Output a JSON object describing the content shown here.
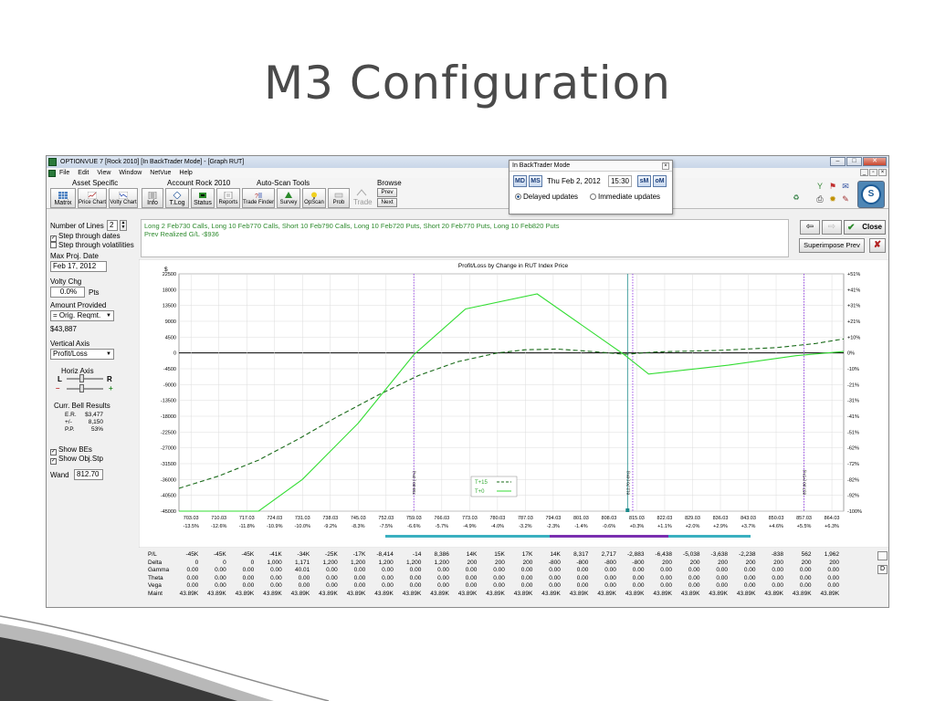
{
  "slide": {
    "title": "M3 Configuration"
  },
  "window": {
    "title": "OPTIONVUE 7  [Rock 2010]  [In BackTrader Mode] - [Graph RUT]",
    "controls": [
      "–",
      "□",
      "✕"
    ]
  },
  "menu": [
    "File",
    "Edit",
    "View",
    "Window",
    "NetVue",
    "Help"
  ],
  "toolbar": {
    "groups": {
      "asset_specific": "Asset Specific",
      "account": "Account Rock 2010",
      "autoscan": "Auto-Scan Tools",
      "browse": "Browse"
    },
    "buttons": [
      {
        "label": "Matrix"
      },
      {
        "label": "Price Chart"
      },
      {
        "label": "Volty Chart"
      },
      {
        "label": "Info"
      },
      {
        "label": "T.Log"
      },
      {
        "label": "Status"
      },
      {
        "label": "Reports"
      },
      {
        "label": "Trade Finder"
      },
      {
        "label": "Survey"
      },
      {
        "label": "OpScan"
      },
      {
        "label": "Prob"
      }
    ],
    "trade_label": "Trade",
    "prev": "Prev",
    "next": "Next"
  },
  "backtrader": {
    "title": "In BackTrader Mode",
    "btn_md": "MD",
    "btn_ms": "MS",
    "date": "Thu Feb 2, 2012",
    "time": "15:30",
    "btn_sm": "sM",
    "btn_om": "oM",
    "delayed": "Delayed updates",
    "immediate": "Immediate updates"
  },
  "left_panel": {
    "number_of_lines_label": "Number of Lines",
    "number_of_lines_value": "2",
    "step_dates": "Step through dates",
    "step_volatilities": "Step through volatilities",
    "max_proj_date_label": "Max Proj. Date",
    "max_proj_date_value": "Feb 17, 2012",
    "volty_chg_label": "Volty Chg",
    "volty_chg_value": "0.0%",
    "volty_chg_unit": "Pts",
    "amount_provided_label": "Amount Provided",
    "amount_provided_combo": "= Orig. Reqmt.",
    "amount_value": "$43,887",
    "vertical_axis_label": "Vertical Axis",
    "vertical_axis_combo": "Profit/Loss",
    "horiz_axis_label": "Horiz Axis",
    "horiz_l": "L",
    "horiz_r": "R",
    "bell_label": "Curr. Bell Results",
    "bell": [
      {
        "k": "E.R.",
        "v": "$3,477"
      },
      {
        "k": "+/-",
        "v": "8,150"
      },
      {
        "k": "P.P.",
        "v": "53%"
      }
    ],
    "show_bes": "Show BEs",
    "show_objstp": "Show Obj.Stp",
    "wand_label": "Wand",
    "wand_value": "812.70"
  },
  "top_info": {
    "position": "Long 2 Feb730 Calls, Long 10 Feb770 Calls, Short 10 Feb790 Calls, Long 10 Feb720 Puts, Short 20 Feb770 Puts, Long 10 Feb820 Puts",
    "realized": "Prev Realized G/L -$936",
    "close": "Close",
    "superimpose": "Superimpose Prev"
  },
  "chart_data": {
    "type": "line",
    "title": "Profit/Loss by Change in RUT Index Price",
    "y_unit_label": "$",
    "y_ticks": [
      22500,
      18000,
      13500,
      9000,
      4500,
      0,
      -4500,
      -9000,
      -13500,
      -18000,
      -22500,
      -27000,
      -31500,
      -36000,
      -40500,
      -45000
    ],
    "y_ticks_right": [
      "+51%",
      "+41%",
      "+31%",
      "+21%",
      "+10%",
      "0%",
      "-10%",
      "-21%",
      "-31%",
      "-41%",
      "-51%",
      "-62%",
      "-72%",
      "-82%",
      "-92%",
      "-100%"
    ],
    "ylim": [
      -45000,
      22500
    ],
    "x_ticks": [
      "703.03",
      "710.03",
      "717.03",
      "724.03",
      "731.03",
      "738.03",
      "745.03",
      "752.03",
      "759.03",
      "766.03",
      "773.03",
      "780.03",
      "787.03",
      "794.03",
      "801.03",
      "808.03",
      "815.03",
      "822.03",
      "829.03",
      "836.03",
      "843.03",
      "850.03",
      "857.03",
      "864.03"
    ],
    "x_pct": [
      "-13.5%",
      "-12.6%",
      "-11.8%",
      "-10.9%",
      "-10.0%",
      "-9.2%",
      "-8.3%",
      "-7.5%",
      "-6.6%",
      "-5.7%",
      "-4.9%",
      "-4.0%",
      "-3.2%",
      "-2.3%",
      "-1.4%",
      "-0.6%",
      "+0.3%",
      "+1.1%",
      "+2.0%",
      "+2.9%",
      "+3.7%",
      "+4.6%",
      "+5.5%",
      "+6.3%"
    ],
    "xlim": [
      700,
      867
    ],
    "series": [
      {
        "name": "T+15",
        "style": "dashed",
        "color": "#1a6b1a",
        "points": [
          [
            700,
            -38500
          ],
          [
            710,
            -35000
          ],
          [
            720,
            -30500
          ],
          [
            730,
            -24500
          ],
          [
            740,
            -18000
          ],
          [
            750,
            -12000
          ],
          [
            760,
            -6500
          ],
          [
            770,
            -2500
          ],
          [
            780,
            0
          ],
          [
            787,
            900
          ],
          [
            795,
            1100
          ],
          [
            805,
            300
          ],
          [
            812,
            -400
          ],
          [
            820,
            300
          ],
          [
            835,
            700
          ],
          [
            850,
            1500
          ],
          [
            860,
            2700
          ],
          [
            867,
            4000
          ]
        ]
      },
      {
        "name": "T+0",
        "style": "solid",
        "color": "#33dd33",
        "points": [
          [
            700,
            -45000
          ],
          [
            720,
            -45000
          ],
          [
            731,
            -36000
          ],
          [
            745,
            -20000
          ],
          [
            759,
            -500
          ],
          [
            772,
            12500
          ],
          [
            790,
            16800
          ],
          [
            812,
            -600
          ],
          [
            818,
            -6000
          ],
          [
            838,
            -3500
          ],
          [
            855,
            -800
          ],
          [
            867,
            400
          ]
        ]
      }
    ],
    "vlines": [
      {
        "x": 759.0,
        "label": "759.00 (-3%)",
        "color": "#8a2be2"
      },
      {
        "x": 812.7,
        "label": "812.70 (-0%)",
        "color": "#1a8a8a"
      },
      {
        "x": 814.0,
        "label": "",
        "color": "#8a2be2"
      },
      {
        "x": 857.0,
        "label": "857.00 (+5%)",
        "color": "#8a2be2"
      }
    ],
    "legend": "bottom-center",
    "grid": true
  },
  "table": {
    "rows": [
      {
        "label": "P/L",
        "values": [
          "-45K",
          "-45K",
          "-45K",
          "-41K",
          "-34K",
          "-25K",
          "-17K",
          "-8,414",
          "-14",
          "8,386",
          "14K",
          "15K",
          "17K",
          "14K",
          "8,317",
          "2,717",
          "-2,883",
          "-6,438",
          "-5,038",
          "-3,638",
          "-2,238",
          "-838",
          "562",
          "1,962"
        ]
      },
      {
        "label": "Delta",
        "values": [
          "0",
          "0",
          "0",
          "1,000",
          "1,171",
          "1,200",
          "1,200",
          "1,200",
          "1,200",
          "1,200",
          "200",
          "200",
          "200",
          "-800",
          "-800",
          "-800",
          "-800",
          "200",
          "200",
          "200",
          "200",
          "200",
          "200",
          "200"
        ]
      },
      {
        "label": "Gamma",
        "values": [
          "0.00",
          "0.00",
          "0.00",
          "0.00",
          "40.01",
          "0.00",
          "0.00",
          "0.00",
          "0.00",
          "0.00",
          "0.00",
          "0.00",
          "0.00",
          "0.00",
          "0.00",
          "0.00",
          "0.00",
          "0.00",
          "0.00",
          "0.00",
          "0.00",
          "0.00",
          "0.00",
          "0.00"
        ]
      },
      {
        "label": "Theta",
        "values": [
          "0.00",
          "0.00",
          "0.00",
          "0.00",
          "0.00",
          "0.00",
          "0.00",
          "0.00",
          "0.00",
          "0.00",
          "0.00",
          "0.00",
          "0.00",
          "0.00",
          "0.00",
          "0.00",
          "0.00",
          "0.00",
          "0.00",
          "0.00",
          "0.00",
          "0.00",
          "0.00",
          "0.00"
        ]
      },
      {
        "label": "Vega",
        "values": [
          "0.00",
          "0.00",
          "0.00",
          "0.00",
          "0.00",
          "0.00",
          "0.00",
          "0.00",
          "0.00",
          "0.00",
          "0.00",
          "0.00",
          "0.00",
          "0.00",
          "0.00",
          "0.00",
          "0.00",
          "0.00",
          "0.00",
          "0.00",
          "0.00",
          "0.00",
          "0.00",
          "0.00"
        ]
      },
      {
        "label": "Maint",
        "values": [
          "43.89K",
          "43.89K",
          "43.89K",
          "43.89K",
          "43.89K",
          "43.89K",
          "43.89K",
          "43.89K",
          "43.89K",
          "43.89K",
          "43.89K",
          "43.89K",
          "43.89K",
          "43.89K",
          "43.89K",
          "43.89K",
          "43.89K",
          "43.89K",
          "43.89K",
          "43.89K",
          "43.89K",
          "43.89K",
          "43.89K",
          "43.89K"
        ]
      }
    ],
    "side_btn_d": "D"
  },
  "colors": {
    "t0_line": "#33dd33",
    "t15_line": "#1a6b1a",
    "info_text": "#2d8a2d",
    "range_bar": "#3ab0c0",
    "range_bar2": "#7a2fb0",
    "swoosh": "#3a3a3a"
  }
}
